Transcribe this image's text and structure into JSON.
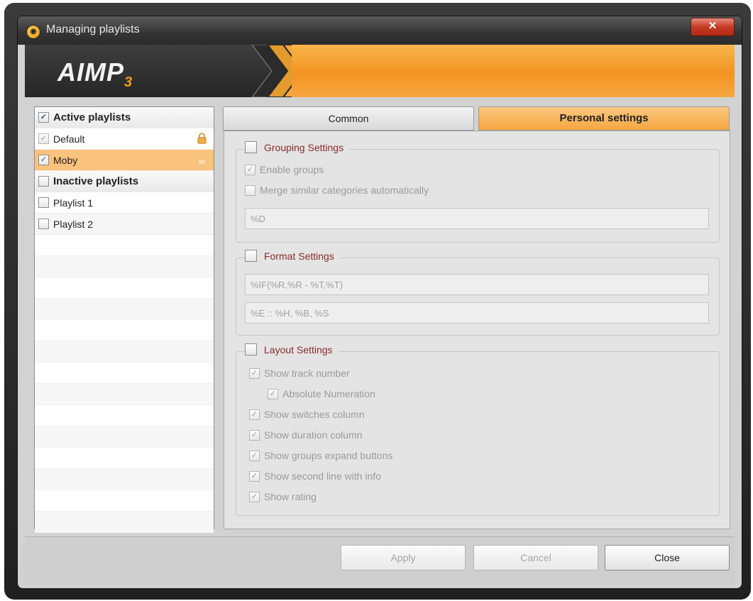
{
  "window": {
    "title": "Managing playlists",
    "close_glyph": "✕"
  },
  "header": {
    "logo": "AIMP",
    "logo_sub": "3"
  },
  "playlists": {
    "active_group": "Active playlists",
    "inactive_group": "Inactive playlists",
    "items": [
      {
        "label": "Default",
        "checked": true,
        "locked": true
      },
      {
        "label": "Moby",
        "checked": true,
        "selected": true
      },
      {
        "label": "Playlist 1",
        "checked": false
      },
      {
        "label": "Playlist 2",
        "checked": false
      }
    ]
  },
  "tabs": {
    "common": "Common",
    "personal": "Personal settings"
  },
  "grouping": {
    "title": "Grouping Settings",
    "enable_groups": "Enable groups",
    "merge": "Merge similar categories automatically",
    "template": "%D"
  },
  "format": {
    "title": "Format Settings",
    "line1": "%IF(%R,%R - %T,%T)",
    "line2": "%E :: %H, %B, %S"
  },
  "layout": {
    "title": "Layout Settings",
    "show_track_number": "Show track number",
    "absolute_numeration": "Absolute Numeration",
    "show_switches": "Show switches column",
    "show_duration": "Show duration column",
    "show_groups_expand": "Show groups expand buttons",
    "show_second_line": "Show second line with info",
    "show_rating": "Show rating"
  },
  "footer": {
    "apply": "Apply",
    "cancel": "Cancel",
    "close": "Close"
  },
  "colors": {
    "accent": "#f39422",
    "selected_row": "#f9c27d",
    "group_title": "#8a2a2a"
  },
  "icons": {
    "app": "aimp-icon",
    "lock": "lock-icon",
    "check": "✓"
  }
}
